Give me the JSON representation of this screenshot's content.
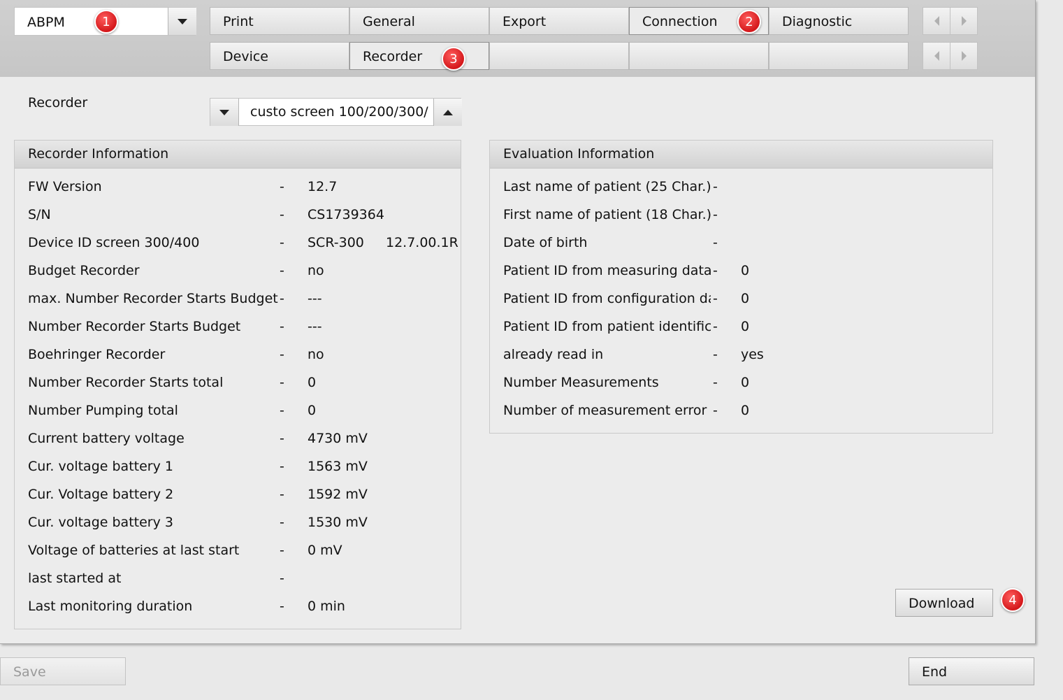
{
  "device_selector": {
    "value": "ABPM"
  },
  "tabs_row1": [
    {
      "label": "Print"
    },
    {
      "label": "General"
    },
    {
      "label": "Export"
    },
    {
      "label": "Connection"
    },
    {
      "label": "Diagnostic"
    }
  ],
  "tabs_row2": [
    {
      "label": "Device"
    },
    {
      "label": "Recorder"
    }
  ],
  "badges": [
    "1",
    "2",
    "3",
    "4"
  ],
  "recorder_selector": {
    "label": "Recorder",
    "value": "custo screen 100/200/300/"
  },
  "recorder_info": {
    "title": "Recorder Information",
    "rows": [
      {
        "label": "FW Version",
        "dash": "-",
        "value": "12.7"
      },
      {
        "label": "S/N",
        "dash": "-",
        "value": "CS1739364"
      },
      {
        "label": "Device ID screen 300/400",
        "dash": "-",
        "value": "SCR-300",
        "value2": "12.7.00.1R"
      },
      {
        "label": "Budget Recorder",
        "dash": "-",
        "value": "no"
      },
      {
        "label": "max. Number Recorder Starts Budget",
        "dash": "-",
        "value": "---"
      },
      {
        "label": "Number Recorder Starts Budget",
        "dash": "-",
        "value": "---"
      },
      {
        "label": "Boehringer Recorder",
        "dash": "-",
        "value": "no"
      },
      {
        "label": "Number Recorder Starts total",
        "dash": "-",
        "value": "0"
      },
      {
        "label": "Number Pumping total",
        "dash": "-",
        "value": "0"
      },
      {
        "label": "Current battery voltage",
        "dash": "-",
        "value": "4730 mV"
      },
      {
        "label": "Cur. voltage battery 1",
        "dash": "-",
        "value": "1563 mV"
      },
      {
        "label": "Cur. Voltage battery 2",
        "dash": "-",
        "value": "1592 mV"
      },
      {
        "label": "Cur. voltage battery 3",
        "dash": "-",
        "value": "1530 mV"
      },
      {
        "label": "Voltage of batteries at last start",
        "dash": "-",
        "value": "0 mV"
      },
      {
        "label": "last started at",
        "dash": "-",
        "value": ""
      },
      {
        "label": "Last monitoring duration",
        "dash": "-",
        "value": "0 min"
      }
    ]
  },
  "evaluation_info": {
    "title": "Evaluation Information",
    "rows": [
      {
        "label": "Last name of patient (25 Char.)",
        "dash": "-",
        "value": ""
      },
      {
        "label": "First name of patient (18 Char.)",
        "dash": "-",
        "value": ""
      },
      {
        "label": "Date of birth",
        "dash": "-",
        "value": ""
      },
      {
        "label": "Patient ID from measuring data",
        "dash": "-",
        "value": "0"
      },
      {
        "label": "Patient ID from configuration data",
        "dash": "-",
        "value": "0"
      },
      {
        "label": "Patient ID from patient identification",
        "dash": "-",
        "value": "0"
      },
      {
        "label": "already read in",
        "dash": "-",
        "value": "yes"
      },
      {
        "label": "Number Measurements",
        "dash": "-",
        "value": "0"
      },
      {
        "label": "Number of measurement error",
        "dash": "-",
        "value": "0"
      }
    ]
  },
  "buttons": {
    "download": "Download",
    "save": "Save",
    "end": "End"
  }
}
